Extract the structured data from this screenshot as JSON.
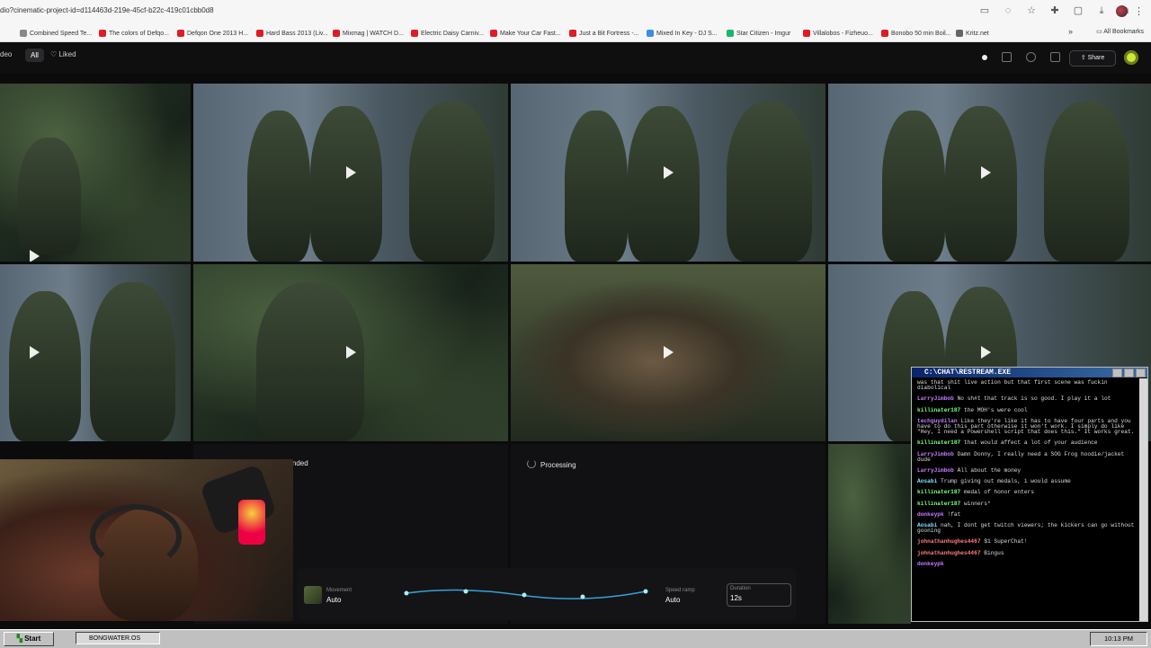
{
  "browser": {
    "url": "dio?cinematic-project-id=d114463d-219e-45cf-b22c-419c01cbb0d8",
    "bookmarks": [
      {
        "label": "Combined Speed Te...",
        "color": "#888888"
      },
      {
        "label": "The colors of Defqo...",
        "color": "#e01b24"
      },
      {
        "label": "Defqon One 2013 H...",
        "color": "#e01b24"
      },
      {
        "label": "Hard Bass 2013 (Liv...",
        "color": "#e01b24"
      },
      {
        "label": "Mixmag | WATCH D...",
        "color": "#e01b24"
      },
      {
        "label": "Electric Daisy Carniv...",
        "color": "#e01b24"
      },
      {
        "label": "Make Your Car Fast...",
        "color": "#e01b24"
      },
      {
        "label": "Just a Bit Fortress -...",
        "color": "#e01b24"
      },
      {
        "label": "Mixed In Key - DJ S...",
        "color": "#3a8ee6"
      },
      {
        "label": "Star Citizen - Imgur",
        "color": "#1bb76e"
      },
      {
        "label": "Villalobos - Fizheuo...",
        "color": "#e01b24"
      },
      {
        "label": "Bonobo 50 min Boil...",
        "color": "#e01b24"
      },
      {
        "label": "Kritz.net",
        "color": "#666666"
      }
    ],
    "more_label": "»",
    "all_bookmarks_label": "All Bookmarks"
  },
  "app": {
    "left_label": "deo",
    "tab_all": "All",
    "tab_liked": "Liked",
    "liked_icon": "♡",
    "share_label": "Share",
    "share_icon": "⇪",
    "accent_color": "#cde83a",
    "refunded_label": "Refunded",
    "processing_label": "Processing"
  },
  "controls": {
    "movement_label": "Movement",
    "movement_value": "Auto",
    "speed_ramp_label": "Speed ramp",
    "speed_ramp_value": "Auto",
    "duration_label": "Duration",
    "duration_value": "12s"
  },
  "chat": {
    "title": "C:\\CHAT\\RESTREAM.EXE",
    "messages": [
      {
        "user": "",
        "text": "was that shit live action but that first scene was fuckin diabolical",
        "cls": "u-c"
      },
      {
        "user": "LarryJimbob",
        "text": " No sh#t that track is so good. I play it a lot",
        "cls": "u-p"
      },
      {
        "user": "killinater187",
        "text": " the MOH's were cool",
        "cls": "u-g"
      },
      {
        "user": "techguydilan",
        "text": " Like they're like it has to have four parts and you have to do this part otherwise it won't work. I simply do like \"Hey, I need a Powershell script that does this.\" It works great.",
        "cls": "u-p"
      },
      {
        "user": "killinater187",
        "text": " that would affect a lot of your audience",
        "cls": "u-g"
      },
      {
        "user": "LarryJimbob",
        "text": " Damn Donny, I really need a SOG Frog hoodie/jacket dude",
        "cls": "u-p"
      },
      {
        "user": "LarryJimbob",
        "text": " All about the money",
        "cls": "u-p"
      },
      {
        "user": "Aosabi",
        "text": " Trump giving out medals, i would assume",
        "cls": "u-c"
      },
      {
        "user": "killinater187",
        "text": " medal of honor enters",
        "cls": "u-g"
      },
      {
        "user": "killinater187",
        "text": " winners*",
        "cls": "u-g"
      },
      {
        "user": "donkeypk",
        "text": " !fat",
        "cls": "u-p"
      },
      {
        "user": "Aosabi",
        "text": " nah, I dont get twitch viewers; the kickers can go without gooning",
        "cls": "u-c"
      },
      {
        "user": "johnathanhughes4467",
        "text": " $1 SuperChat!",
        "cls": "u-r"
      },
      {
        "user": "johnathanhughes4467",
        "text": " Bingus",
        "cls": "u-r"
      },
      {
        "user": "donkeypk",
        "text": " ",
        "cls": "u-p"
      }
    ]
  },
  "taskbar": {
    "start_label": "Start",
    "window_label": "BONGWATER.OS",
    "clock": "10:13 PM"
  }
}
